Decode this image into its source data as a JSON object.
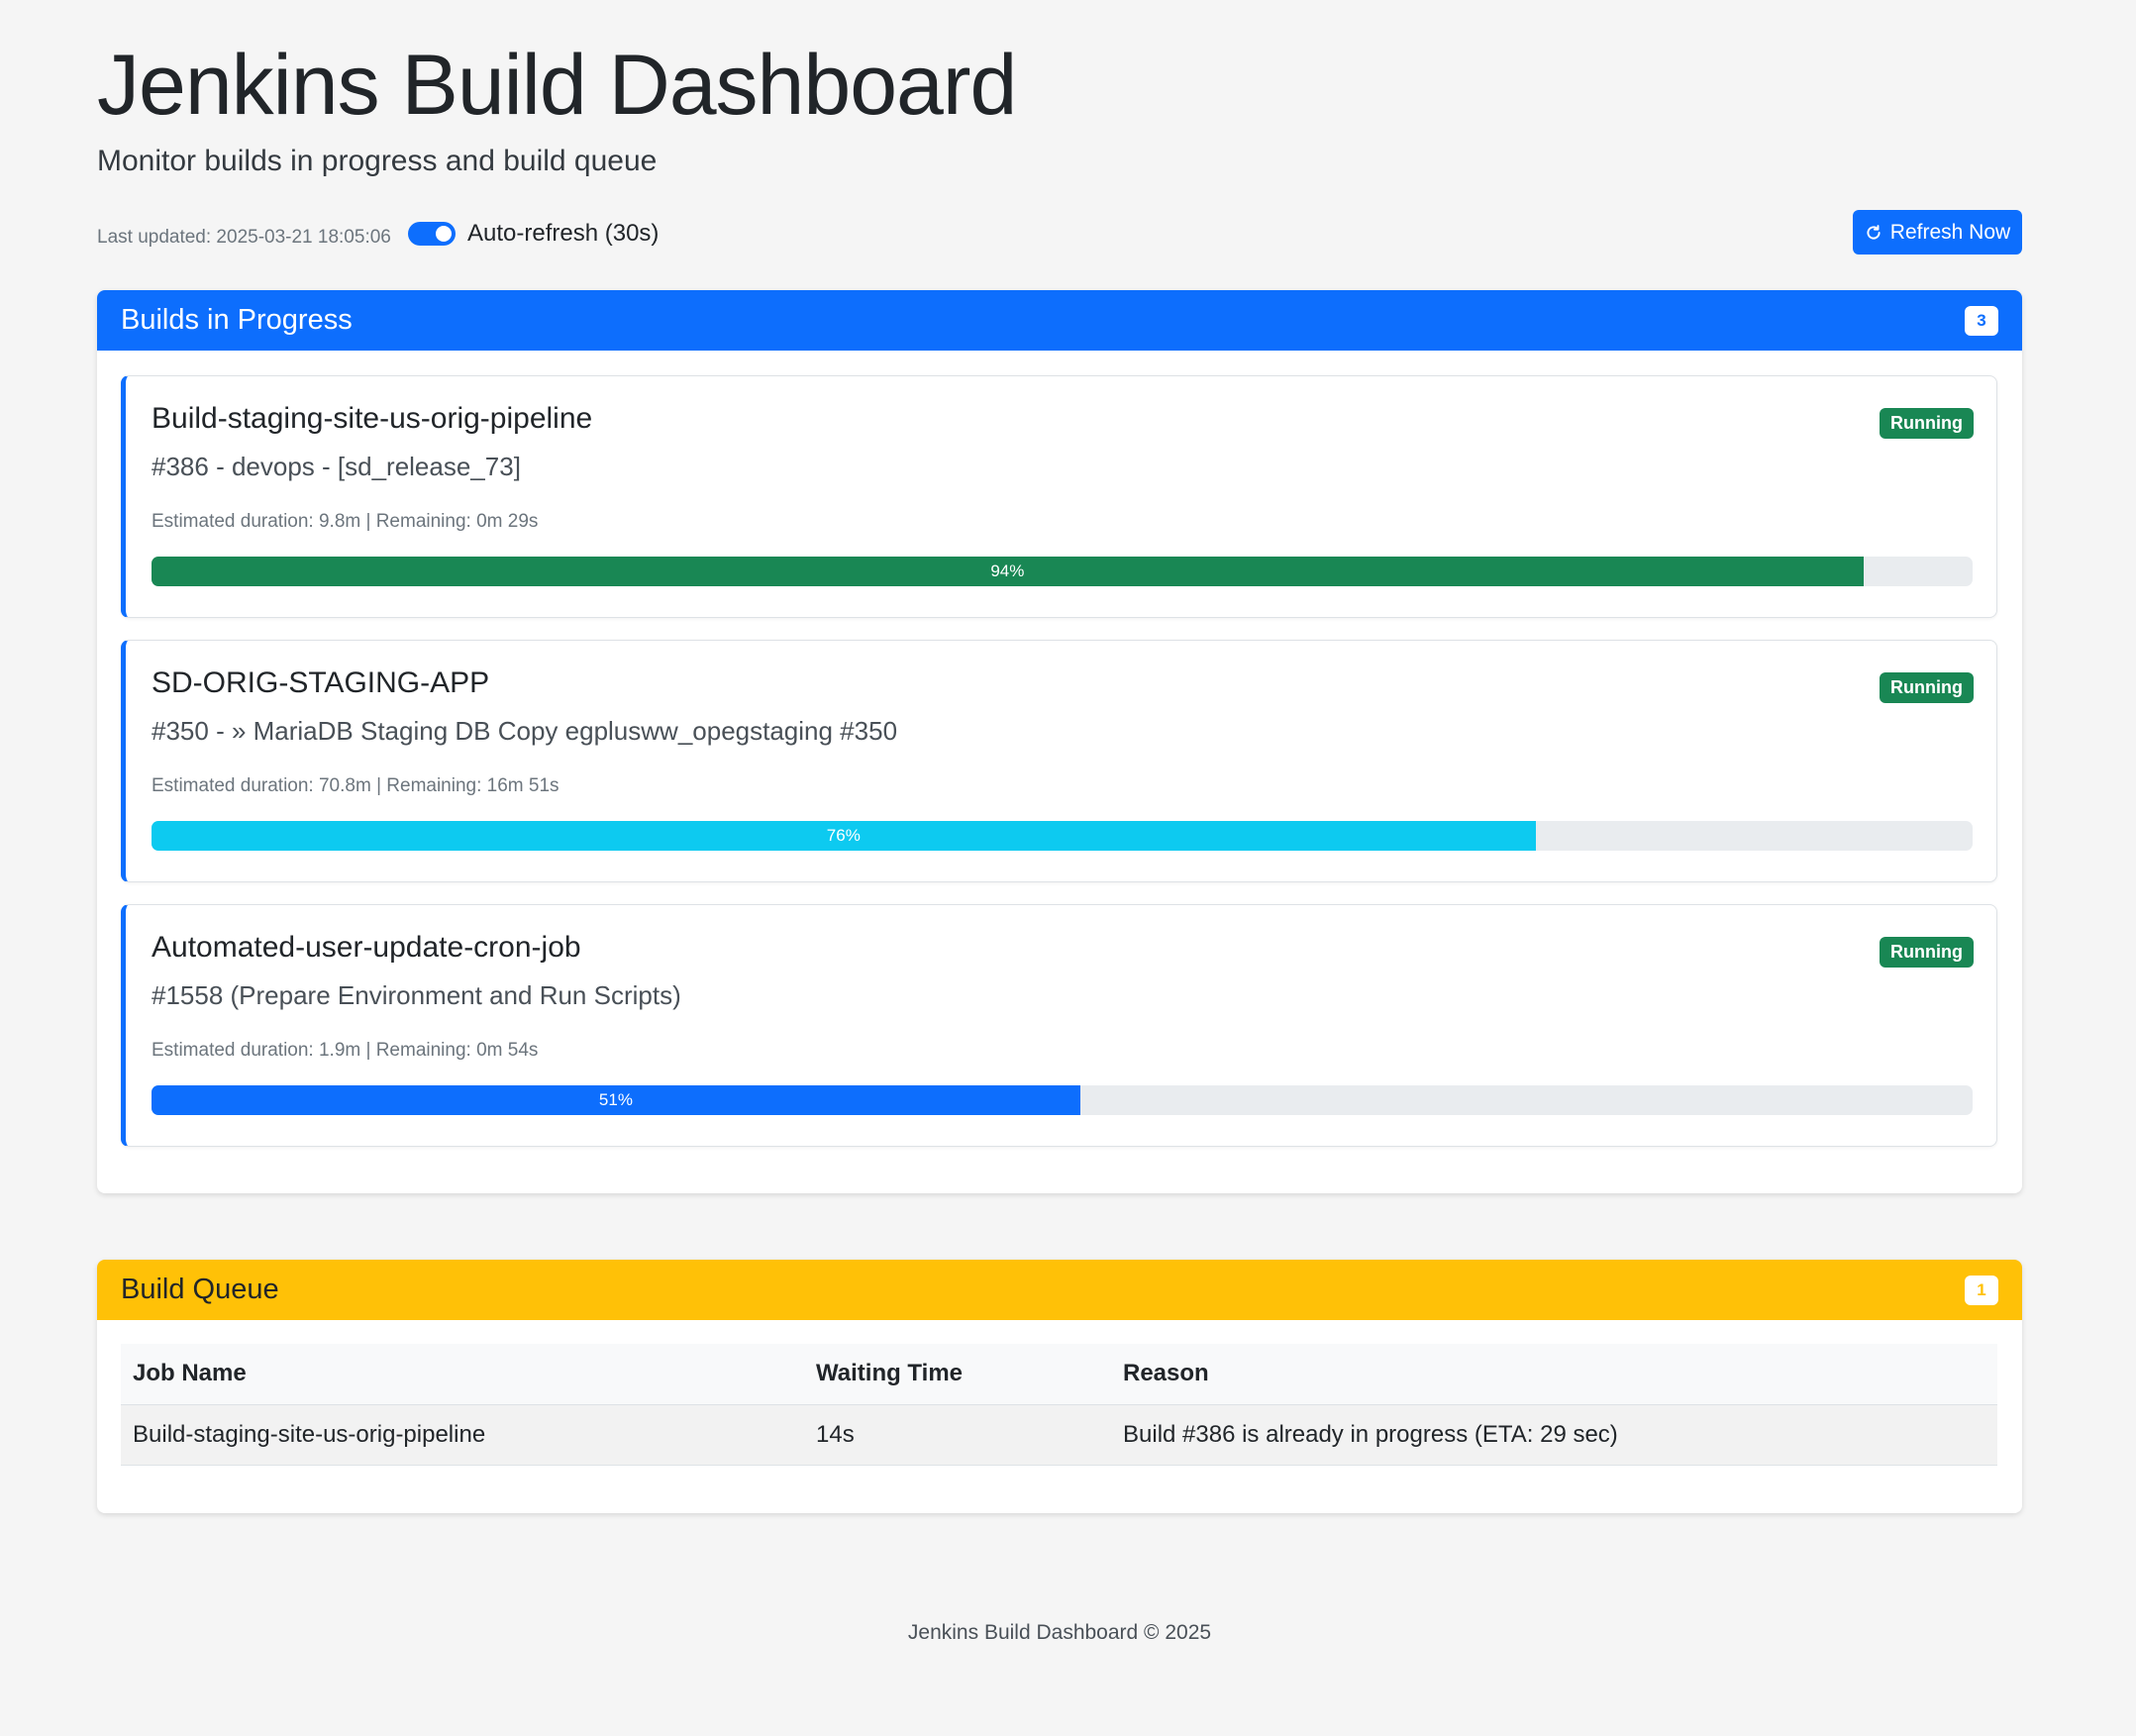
{
  "header": {
    "title": "Jenkins Build Dashboard",
    "subtitle": "Monitor builds in progress and build queue"
  },
  "toolbar": {
    "last_updated": "Last updated: 2025-03-21 18:05:06",
    "auto_refresh_label": "Auto-refresh (30s)",
    "auto_refresh_on": true,
    "refresh_button_label": "Refresh Now"
  },
  "builds_panel": {
    "title": "Builds in Progress",
    "count": "3",
    "builds": [
      {
        "name": "Build-staging-site-us-orig-pipeline",
        "info": "#386 - devops - [sd_release_73]",
        "meta": "Estimated duration: 9.8m | Remaining: 0m 29s",
        "status": "Running",
        "progress": 94,
        "progress_label": "94%",
        "bar_color": "#198754"
      },
      {
        "name": "SD-ORIG-STAGING-APP",
        "info": "#350 - » MariaDB Staging DB Copy egplusww_opegstaging #350",
        "meta": "Estimated duration: 70.8m | Remaining: 16m 51s",
        "status": "Running",
        "progress": 76,
        "progress_label": "76%",
        "bar_color": "#0dcaf0"
      },
      {
        "name": "Automated-user-update-cron-job",
        "info": "#1558 (Prepare Environment and Run Scripts)",
        "meta": "Estimated duration: 1.9m | Remaining: 0m 54s",
        "status": "Running",
        "progress": 51,
        "progress_label": "51%",
        "bar_color": "#0d6efd"
      }
    ]
  },
  "queue_panel": {
    "title": "Build Queue",
    "count": "1",
    "columns": [
      "Job Name",
      "Waiting Time",
      "Reason"
    ],
    "rows": [
      {
        "job": "Build-staging-site-us-orig-pipeline",
        "waiting": "14s",
        "reason": "Build #386 is already in progress (ETA: 29 sec)"
      }
    ]
  },
  "footer": {
    "text": "Jenkins Build Dashboard © 2025"
  },
  "colors": {
    "primary": "#0d6efd",
    "warning": "#ffc107",
    "success": "#198754",
    "info": "#0dcaf0"
  }
}
